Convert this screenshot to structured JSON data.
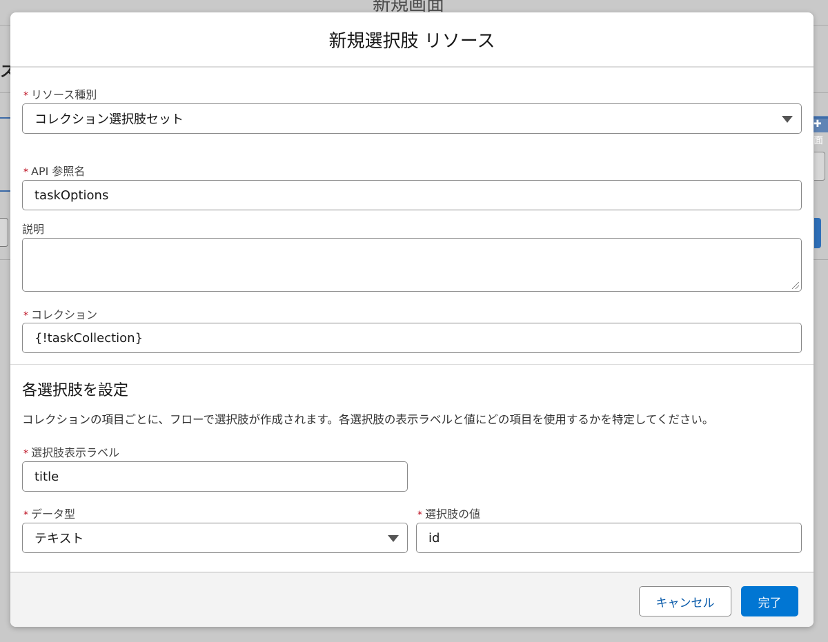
{
  "background": {
    "top_title": "新規画面",
    "left_text": "ス",
    "right_badge": "✚ 面"
  },
  "modal": {
    "title": "新規選択肢 リソース",
    "resource_type": {
      "label": "リソース種別",
      "value": "コレクション選択肢セット"
    },
    "api_name": {
      "label": "API 参照名",
      "value": "taskOptions"
    },
    "description": {
      "label": "説明",
      "value": ""
    },
    "collection": {
      "label": "コレクション",
      "value": "{!taskCollection}"
    },
    "choice_section": {
      "title": "各選択肢を設定",
      "description": "コレクションの項目ごとに、フローで選択肢が作成されます。各選択肢の表示ラベルと値にどの項目を使用するかを特定してください。"
    },
    "choice_label": {
      "label": "選択肢表示ラベル",
      "value": "title"
    },
    "data_type": {
      "label": "データ型",
      "value": "テキスト"
    },
    "choice_value": {
      "label": "選択肢の値",
      "value": "id"
    },
    "required_mark": "*",
    "footer": {
      "cancel_label": "キャンセル",
      "done_label": "完了"
    }
  },
  "colors": {
    "brand": "#0176d3",
    "required": "#ba0517"
  }
}
